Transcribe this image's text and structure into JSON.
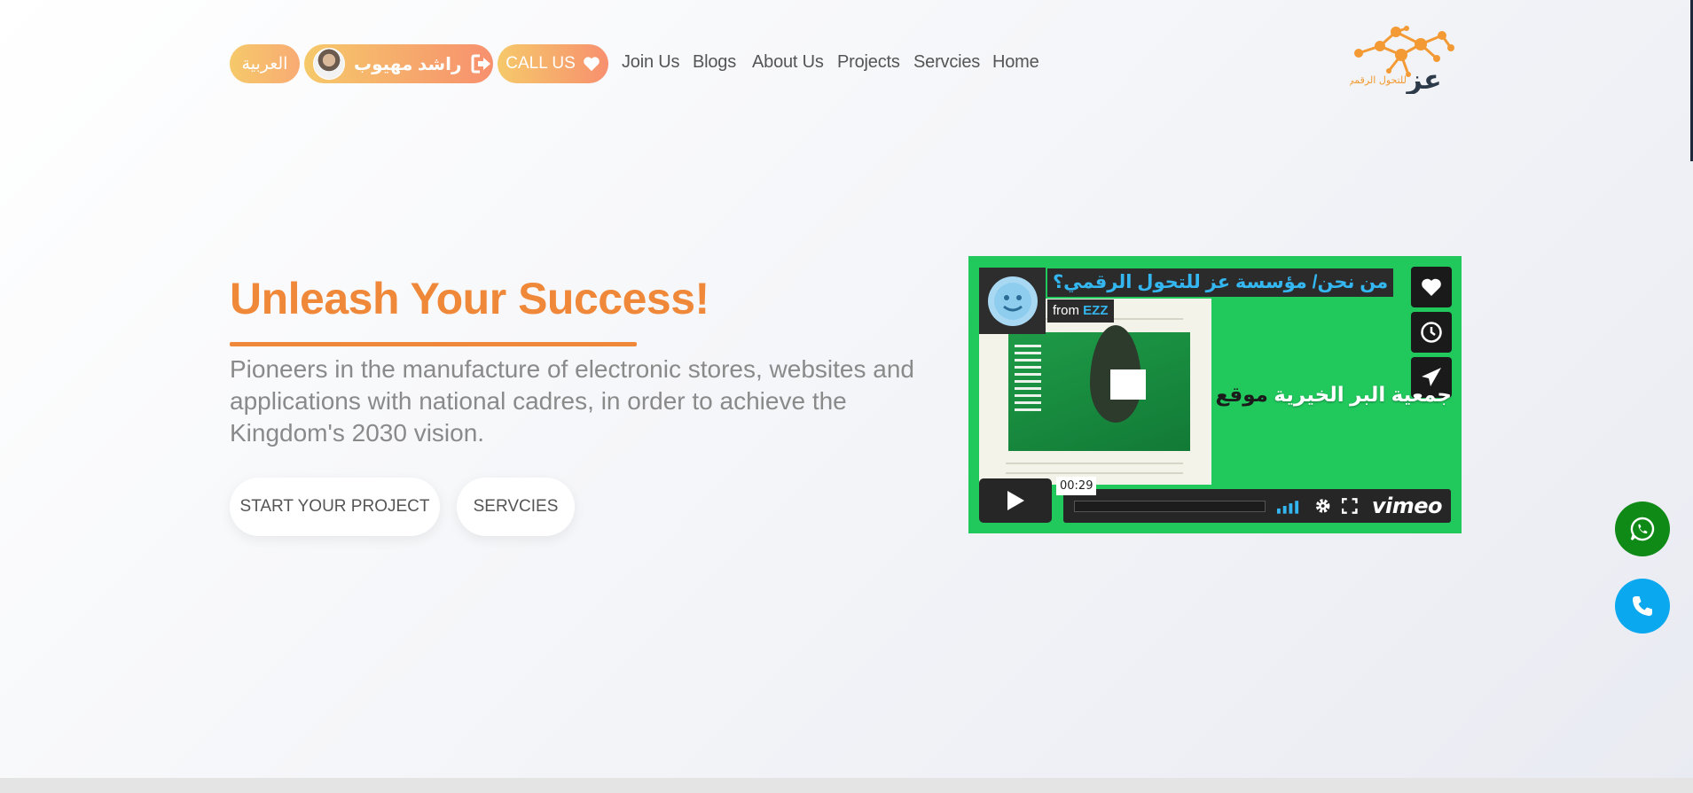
{
  "header": {
    "logo_text": "عز",
    "logo_tagline": "للتحول الرقمي",
    "nav": [
      {
        "label": "Home"
      },
      {
        "label": "Servcies"
      },
      {
        "label": "Projects"
      },
      {
        "label": "About Us"
      },
      {
        "label": "Blogs"
      },
      {
        "label": "Join Us"
      }
    ],
    "call_label": "CALL US",
    "user_name": "راشد مهيوب",
    "language_label": "العربية"
  },
  "hero": {
    "title": "Unleash Your Success!",
    "description": "Pioneers in the manufacture of electronic stores, websites and applications with national cadres, in order to achieve the Kingdom's 2030 vision.",
    "start_button": "START YOUR PROJECT",
    "services_button": "SERVCIES"
  },
  "video": {
    "title": "من نحن/ مؤسسة عز للتحول الرقمي؟",
    "from_prefix": "from",
    "from_channel": "EZZ",
    "caption_dark": "موقع",
    "caption_light": "جمعية البر الخيرية",
    "duration": "00:29",
    "brand": "vimeo",
    "accent_color": "#34b7f1",
    "background_color": "#21c95d"
  },
  "floating": {
    "whatsapp_color": "#0f8a16",
    "phone_color": "#0aa8ef"
  },
  "colors": {
    "accent": "#f0883a",
    "pill_gradient_start": "#f6c96a",
    "pill_gradient_end": "#f7906e"
  }
}
